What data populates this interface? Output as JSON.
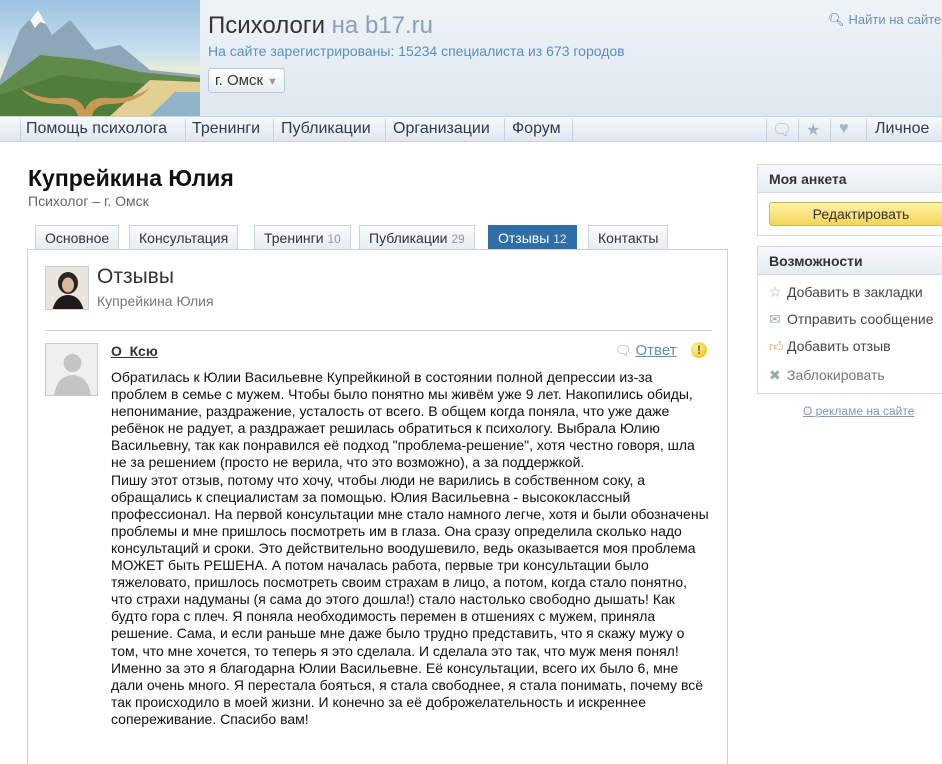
{
  "header": {
    "title": "Психологи",
    "title_domain": "на b17.ru",
    "subtitle": "На сайте зарегистрированы: 15234 специалиста из 673 городов",
    "city": "г. Омск",
    "search": "Найти на сайте"
  },
  "nav": {
    "items": [
      "Помощь психолога",
      "Тренинги",
      "Публикации",
      "Организации",
      "Форум"
    ],
    "personal": "Личное"
  },
  "profile": {
    "name": "Купрейкина Юлия",
    "role": "Психолог – г. Омск"
  },
  "tabs": [
    {
      "label": "Основное",
      "count": ""
    },
    {
      "label": "Консультация",
      "count": ""
    },
    {
      "label": "Тренинги",
      "count": "10"
    },
    {
      "label": "Публикации",
      "count": "29"
    },
    {
      "label": "Отзывы",
      "count": "12"
    },
    {
      "label": "Контакты",
      "count": ""
    }
  ],
  "panel": {
    "title": "Отзывы",
    "subtitle": "Купрейкина Юлия"
  },
  "review": {
    "author": "О_Ксю",
    "reply": "Ответ",
    "paragraphs": [
      "Обратилась к Юлии Васильевне Купрейкиной в состоянии полной депрессии из-за проблем в семье с мужем. Чтобы было понятно мы живём уже 9 лет. Накопились обиды, непонимание, раздражение, усталость от всего. В общем когда поняла, что уже даже ребёнок не радует, а раздражает решилась обратиться к психологу. Выбрала Юлию Васильевну, так как понравился её подход \"проблема-решение\", хотя честно говоря, шла не за решением (просто не верила, что это возможно), а за поддержкой.",
      "Пишу этот отзыв, потому что хочу, чтобы люди не варились в собственном соку, а обращались к специалистам за помощью. Юлия Васильевна - высококлассный профессионал. На первой консультации мне стало намного легче, хотя и были обозначены проблемы и мне пришлось посмотреть им в глаза. Она сразу определила сколько надо консультаций и сроки. Это действительно воодушевило, ведь оказывается моя проблема МОЖЕТ быть РЕШЕНА. А потом началась работа, первые три консультации было тяжеловато, пришлось посмотреть своим страхам в лицо, а потом, когда стало понятно, что страхи надуманы (я сама до этого дошла!) стало настолько свободно дышать! Как будто гора с плеч. Я поняла необходимость перемен в отшениях с мужем, приняла решение. Сама, и если раньше мне даже было трудно представить, что я скажу мужу о том, что мне хочется, то теперь я это сделала. И сделала это так, что муж меня понял!",
      "Именно за это я благодарна Юлии Васильевне. Её консультации, всего их было 6, мне дали очень много. Я перестала бояться, я стала свободнее, я стала понимать, почему всё так происходило в моей жизни. И конечно за её доброжелательность и искреннее сопереживание. Спасибо вам!"
    ]
  },
  "sidebar": {
    "anketa_title": "Моя анкета",
    "edit_button": "Редактировать",
    "features_title": "Возможности",
    "features": [
      {
        "label": "Добавить в закладки",
        "icon": "star-icon"
      },
      {
        "label": "Отправить сообщение",
        "icon": "envelope-icon"
      },
      {
        "label": "Добавить отзыв",
        "icon": "thumbs-up-icon"
      },
      {
        "label": "Заблокировать",
        "icon": "cross-icon"
      }
    ],
    "ad_link": "О рекламе на сайте"
  },
  "colors": {
    "accent": "#2f6ea6",
    "link": "#5a8fc0",
    "edit_button": "#f3d45a"
  }
}
